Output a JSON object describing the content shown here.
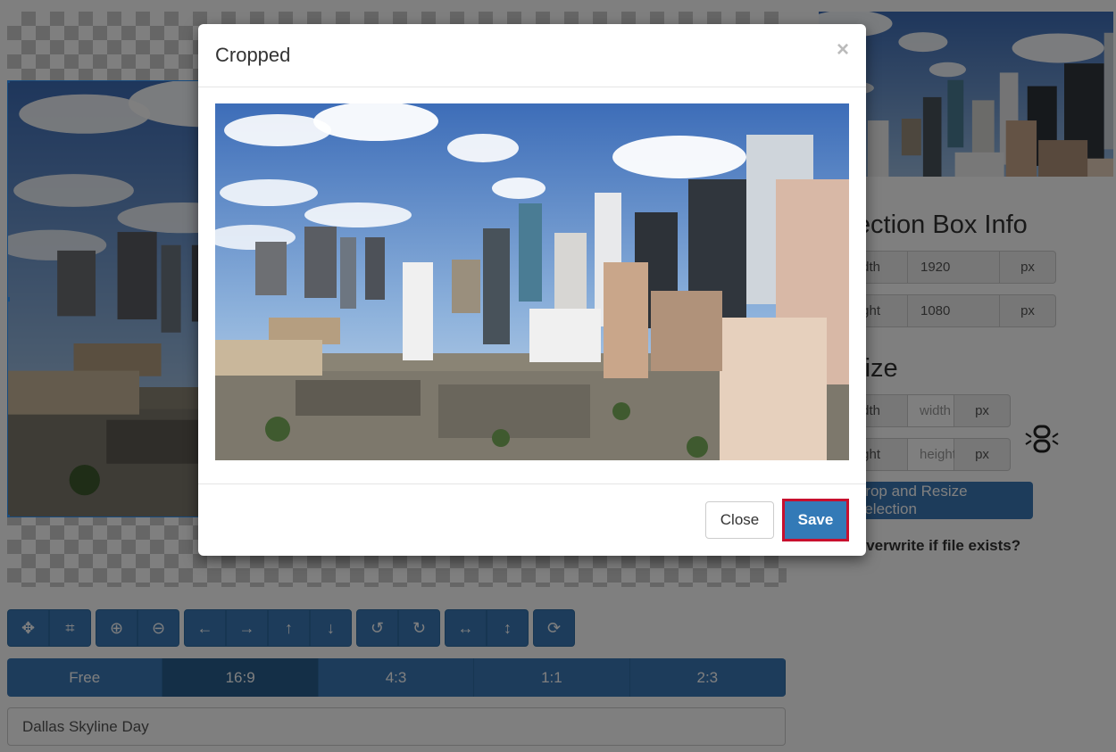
{
  "editor": {
    "toolbar_groups": [
      [
        {
          "icon": "move-icon",
          "glyph": "✥"
        },
        {
          "icon": "crop-icon",
          "glyph": "⌗"
        }
      ],
      [
        {
          "icon": "zoom-in-icon",
          "glyph": "⊕"
        },
        {
          "icon": "zoom-out-icon",
          "glyph": "⊖"
        }
      ],
      [
        {
          "icon": "arrow-left-icon",
          "glyph": "←"
        },
        {
          "icon": "arrow-right-icon",
          "glyph": "→"
        },
        {
          "icon": "arrow-up-icon",
          "glyph": "↑"
        },
        {
          "icon": "arrow-down-icon",
          "glyph": "↓"
        }
      ],
      [
        {
          "icon": "rotate-left-icon",
          "glyph": "↺"
        },
        {
          "icon": "rotate-right-icon",
          "glyph": "↻"
        }
      ],
      [
        {
          "icon": "flip-horizontal-icon",
          "glyph": "↔"
        },
        {
          "icon": "flip-vertical-icon",
          "glyph": "↕"
        }
      ],
      [
        {
          "icon": "reset-icon",
          "glyph": "⟳"
        }
      ]
    ],
    "aspect_ratios": [
      "Free",
      "16:9",
      "4:3",
      "1:1",
      "2:3"
    ],
    "active_ratio": "16:9",
    "filename_value": "Dallas Skyline Day"
  },
  "sidebar": {
    "selection_title": "Selection Box Info",
    "width_label": "Width",
    "width_value": "1920",
    "height_label": "Height",
    "height_value": "1080",
    "unit": "px",
    "resize_title": "Resize",
    "resize_width_placeholder": "width",
    "resize_height_placeholder": "height",
    "apply_button": "Crop and Resize Selection",
    "overwrite_label": "Overwrite if file exists?"
  },
  "modal": {
    "title": "Cropped",
    "close_x": "×",
    "close_button": "Close",
    "save_button": "Save"
  },
  "colors": {
    "primary": "#337ab7",
    "highlight": "#c8102e"
  }
}
